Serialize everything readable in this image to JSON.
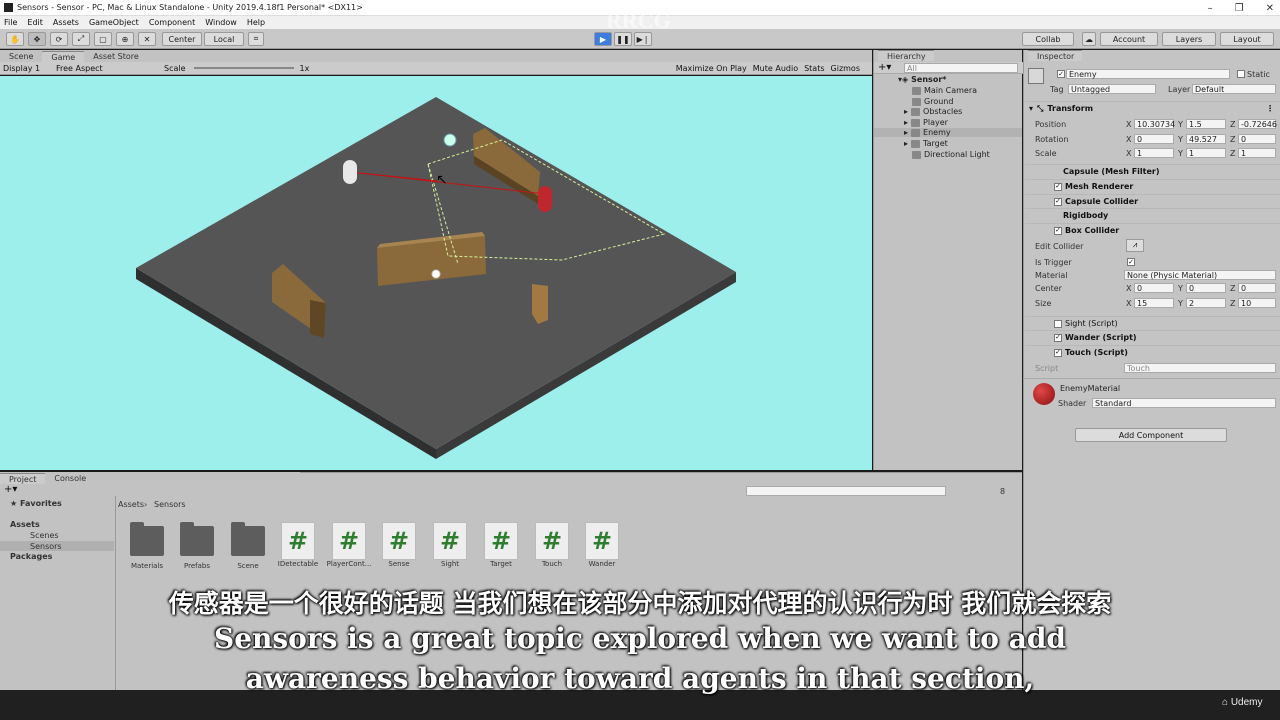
{
  "window": {
    "title": "Sensors - Sensor - PC, Mac & Linux Standalone - Unity 2019.4.18f1 Personal* <DX11>"
  },
  "menu": [
    "File",
    "Edit",
    "Assets",
    "GameObject",
    "Component",
    "Window",
    "Help"
  ],
  "toolbar": {
    "center": "Center",
    "local": "Local",
    "collab": "Collab",
    "account": "Account",
    "layers": "Layers",
    "layout": "Layout"
  },
  "scene_tabs": [
    "Scene",
    "Game",
    "Asset Store"
  ],
  "game_bar": {
    "display": "Display 1",
    "aspect": "Free Aspect",
    "scale_label": "Scale",
    "scale_value": "1x",
    "maximize": "Maximize On Play",
    "mute": "Mute Audio",
    "stats": "Stats",
    "gizmos": "Gizmos"
  },
  "hierarchy": {
    "tab": "Hierarchy",
    "search": "All",
    "scene": "Sensor*",
    "items": [
      "Main Camera",
      "Ground",
      "Obstacles",
      "Player",
      "Enemy",
      "Target",
      "Directional Light"
    ]
  },
  "inspector": {
    "tab": "Inspector",
    "name": "Enemy",
    "static": "Static",
    "tag_label": "Tag",
    "tag": "Untagged",
    "layer_label": "Layer",
    "layer": "Default",
    "transform": "Transform",
    "position": {
      "label": "Position",
      "x": "10.30734",
      "y": "1.5",
      "z": "-0.72646"
    },
    "rotation": {
      "label": "Rotation",
      "x": "0",
      "y": "49.527",
      "z": "0"
    },
    "scale": {
      "label": "Scale",
      "x": "1",
      "y": "1",
      "z": "1"
    },
    "components": [
      "Capsule (Mesh Filter)",
      "Mesh Renderer",
      "Capsule Collider",
      "Rigidbody",
      "Box Collider"
    ],
    "box": {
      "edit": "Edit Collider",
      "trigger": "Is Trigger",
      "material_label": "Material",
      "material": "None (Physic Material)",
      "center_label": "Center",
      "cx": "0",
      "cy": "0",
      "cz": "0",
      "size_label": "Size",
      "sx": "15",
      "sy": "2",
      "sz": "10"
    },
    "scripts": [
      "Sight (Script)",
      "Wander (Script)",
      "Touch (Script)"
    ],
    "script_label": "Script",
    "script_value": "Touch",
    "material_name": "EnemyMaterial",
    "shader_label": "Shader",
    "shader": "Standard",
    "add_component": "Add Component"
  },
  "project": {
    "tabs": [
      "Project",
      "Console"
    ],
    "favorites": "Favorites",
    "tree": [
      "Assets",
      "Scenes",
      "Sensors",
      "Packages"
    ],
    "breadcrumb": [
      "Assets",
      "Sensors"
    ],
    "count": "8",
    "assets": [
      {
        "name": "Materials",
        "kind": "folder"
      },
      {
        "name": "Prefabs",
        "kind": "folder"
      },
      {
        "name": "Scene",
        "kind": "folder"
      },
      {
        "name": "IDetectable",
        "kind": "script"
      },
      {
        "name": "PlayerCont...",
        "kind": "script"
      },
      {
        "name": "Sense",
        "kind": "script"
      },
      {
        "name": "Sight",
        "kind": "script"
      },
      {
        "name": "Target",
        "kind": "script"
      },
      {
        "name": "Touch",
        "kind": "script"
      },
      {
        "name": "Wander",
        "kind": "script"
      }
    ]
  },
  "subtitle": {
    "zh": "传感器是一个很好的话题 当我们想在该部分中添加对代理的认识行为时 我们就会探索",
    "en1": "Sensors is a great topic explored when we want to add",
    "en2": "awareness behavior toward agents in that section,"
  },
  "watermark": "RRCG",
  "brand": "Udemy",
  "colors": {
    "scene_bg": "#9cefea",
    "ground": "#555555",
    "wall": "#8a6a3a",
    "enemy": "#c0272d",
    "play": "#3b7de0"
  }
}
